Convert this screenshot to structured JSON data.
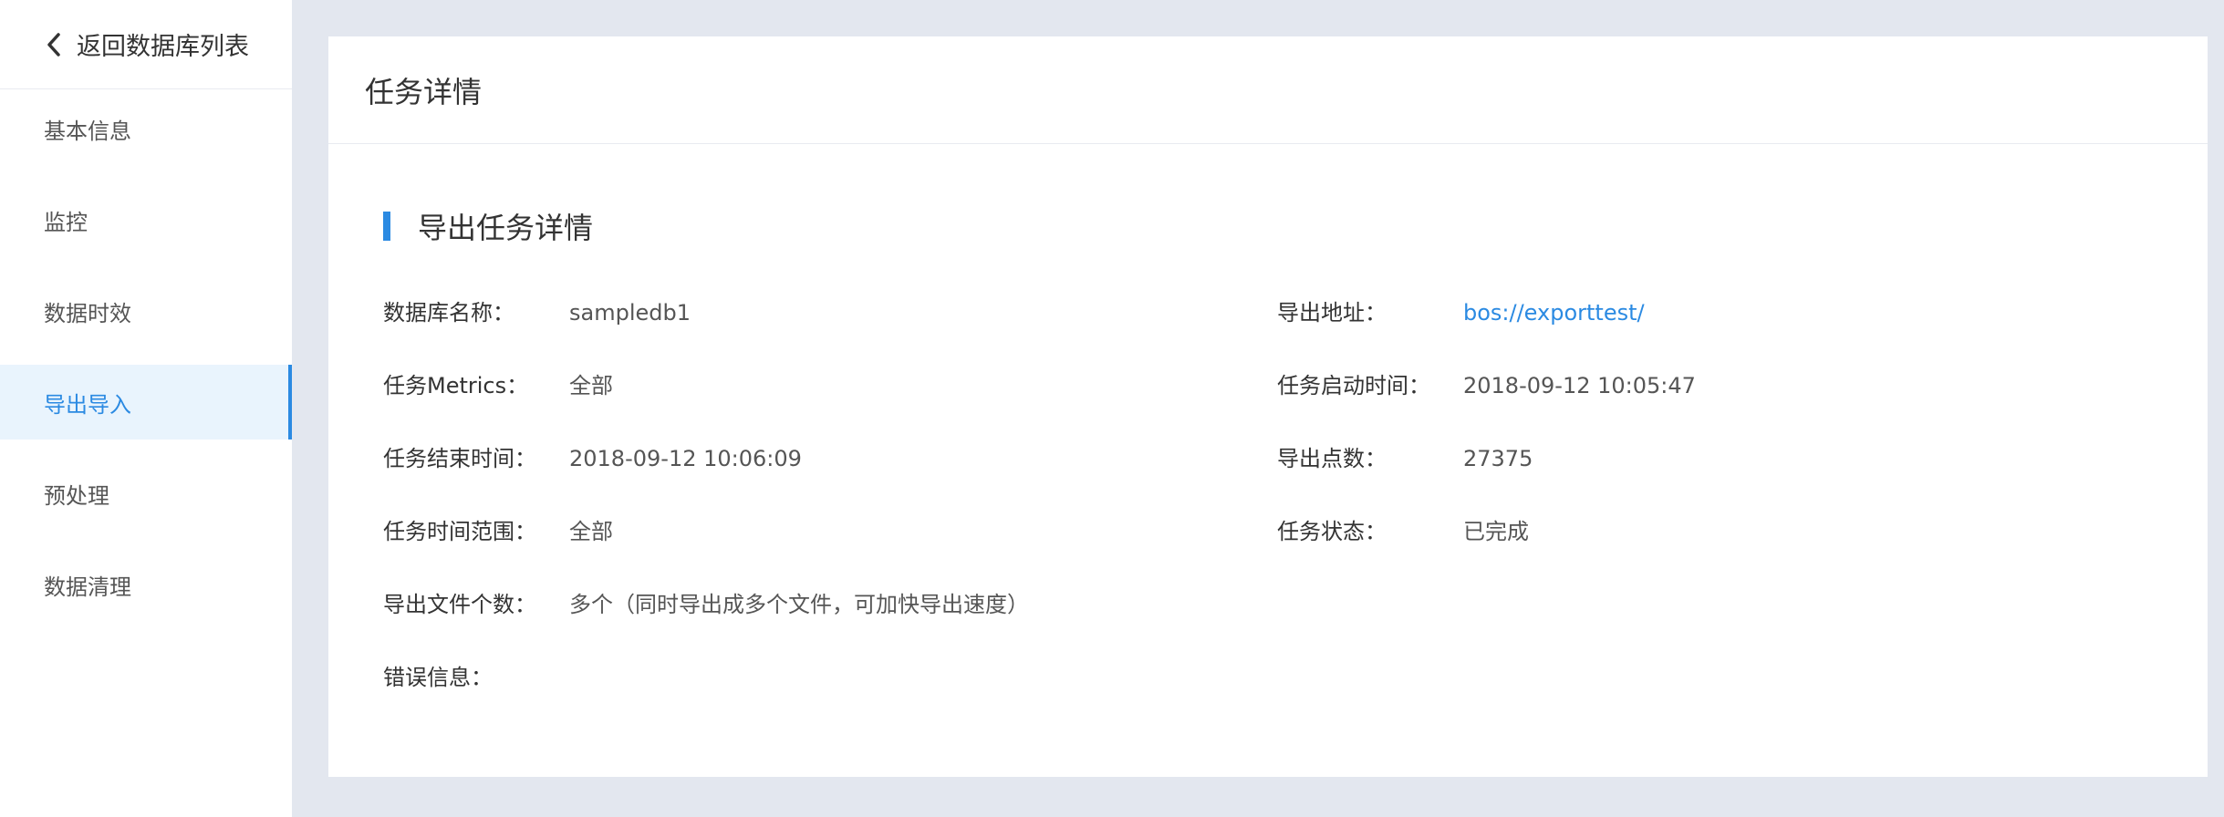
{
  "sidebar": {
    "back_label": "返回数据库列表",
    "items": [
      {
        "label": "基本信息"
      },
      {
        "label": "监控"
      },
      {
        "label": "数据时效"
      },
      {
        "label": "导出导入"
      },
      {
        "label": "预处理"
      },
      {
        "label": "数据清理"
      }
    ],
    "active_index": 3
  },
  "main": {
    "title": "任务详情",
    "section_title": "导出任务详情",
    "fields": {
      "db_name": {
        "label": "数据库名称：",
        "value": "sampledb1"
      },
      "export_address": {
        "label": "导出地址：",
        "value": "bos://exporttest/"
      },
      "metrics": {
        "label": "任务Metrics：",
        "value": "全部"
      },
      "start_time": {
        "label": "任务启动时间：",
        "value": "2018-09-12 10:05:47"
      },
      "end_time": {
        "label": "任务结束时间：",
        "value": "2018-09-12 10:06:09"
      },
      "points": {
        "label": "导出点数：",
        "value": "27375"
      },
      "time_range": {
        "label": "任务时间范围：",
        "value": "全部"
      },
      "status": {
        "label": "任务状态：",
        "value": "已完成"
      },
      "file_count": {
        "label": "导出文件个数：",
        "value": "多个（同时导出成多个文件，可加快导出速度）"
      },
      "error": {
        "label": "错误信息：",
        "value": ""
      }
    }
  },
  "colors": {
    "accent": "#2b8ae2",
    "page_bg": "#e3e7ef",
    "active_bg": "#e9f4fd"
  }
}
